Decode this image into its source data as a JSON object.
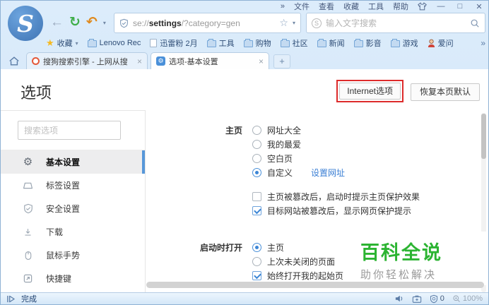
{
  "icons": {
    "back": "←",
    "refresh": "↻",
    "undo": "↶",
    "caret_down": "▾",
    "menu_overflow": "»",
    "bookmarks_overflow": "»",
    "star_outline": "☆",
    "star_filled": "★",
    "minimize": "—",
    "maximize": "□",
    "close": "✕",
    "tab_close": "×",
    "new_tab": "+",
    "gear": "⚙",
    "logo_s": "S",
    "s_badge": "S"
  },
  "window": {
    "menu_items": [
      "文件",
      "查看",
      "收藏",
      "工具",
      "帮助"
    ]
  },
  "toolbar": {
    "address": {
      "prefix": "se://",
      "bold": "settings",
      "suffix": "/?category=gen"
    },
    "search": {
      "placeholder": "输入文字搜索"
    }
  },
  "bookmarks": {
    "favorites_label": "收藏",
    "items": [
      {
        "label": "Lenovo Rec",
        "icon": "folder"
      },
      {
        "label": "迅雷粉 2月",
        "icon": "page"
      },
      {
        "label": "工具",
        "icon": "folder"
      },
      {
        "label": "购物",
        "icon": "folder"
      },
      {
        "label": "社区",
        "icon": "folder"
      },
      {
        "label": "新闻",
        "icon": "folder"
      },
      {
        "label": "影音",
        "icon": "folder"
      },
      {
        "label": "游戏",
        "icon": "folder"
      },
      {
        "label": "爱问",
        "icon": "person"
      }
    ]
  },
  "tabs": [
    {
      "title": "搜狗搜索引擎 - 上网从搜",
      "active": false
    },
    {
      "title": "选项-基本设置",
      "active": true
    }
  ],
  "page": {
    "title": "选项",
    "internet_button": "Internet选项",
    "restore_button": "恢复本页默认",
    "sidebar": {
      "search_placeholder": "搜索选项",
      "items": [
        {
          "label": "基本设置",
          "selected": true
        },
        {
          "label": "标签设置",
          "selected": false
        },
        {
          "label": "安全设置",
          "selected": false
        },
        {
          "label": "下载",
          "selected": false
        },
        {
          "label": "鼠标手势",
          "selected": false
        },
        {
          "label": "快捷键",
          "selected": false
        }
      ]
    },
    "sections": [
      {
        "label": "主页",
        "radios": [
          {
            "label": "网址大全",
            "checked": false
          },
          {
            "label": "我的最爱",
            "checked": false
          },
          {
            "label": "空白页",
            "checked": false
          },
          {
            "label": "自定义",
            "checked": true,
            "link": "设置网址"
          }
        ],
        "checkboxes": [
          {
            "label": "主页被篡改后，启动时提示主页保护效果",
            "checked": false
          },
          {
            "label": "目标网站被篡改后，显示网页保护提示",
            "checked": true
          }
        ]
      },
      {
        "label": "启动时打开",
        "radios": [
          {
            "label": "主页",
            "checked": true
          },
          {
            "label": "上次未关闭的页面",
            "checked": false
          }
        ],
        "checkboxes": [
          {
            "label": "始终打开我的起始页",
            "checked": true
          }
        ]
      }
    ],
    "watermark": {
      "title": "百科全说",
      "subtitle": "助你轻松解决"
    }
  },
  "statusbar": {
    "status": "完成",
    "blocked_count": "0",
    "zoom_level": "100%"
  },
  "colors": {
    "accent_blue": "#4a90d9",
    "link_blue": "#3b7fd4",
    "annotation_red": "#dd2b2b",
    "watermark_green": "#2cb432",
    "refresh_green": "#3fae49",
    "undo_orange": "#e08a1e",
    "star_gold": "#f5b921",
    "chrome_bg": "#d9eafa"
  }
}
